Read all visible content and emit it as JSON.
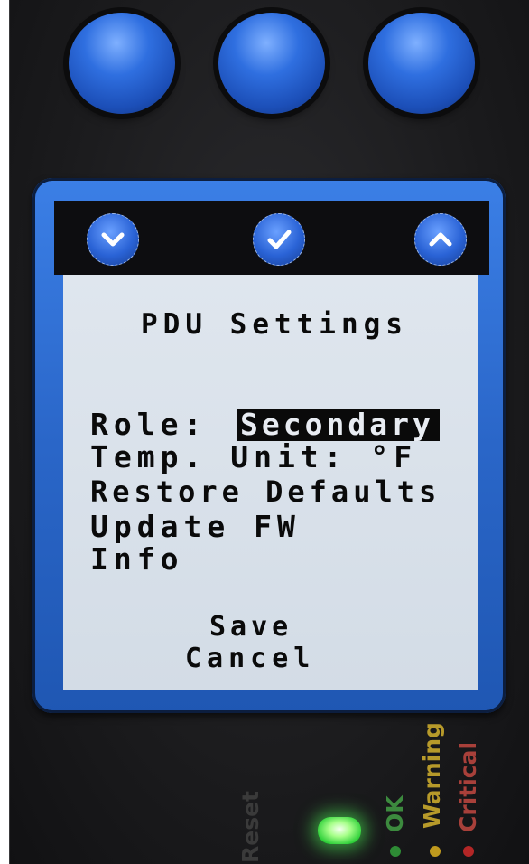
{
  "screen": {
    "title": "PDU Settings",
    "menu": {
      "role_label": "Role:",
      "role_value": "Secondary",
      "temp_unit": "Temp. Unit: °F",
      "restore_defaults": "Restore Defaults",
      "update_fw": "Update FW",
      "info": "Info"
    },
    "actions": {
      "save": "Save",
      "cancel": "Cancel"
    }
  },
  "nav_icons": [
    "chevron-down-icon",
    "checkmark-icon",
    "chevron-up-icon"
  ],
  "indicators": {
    "reset": "Reset",
    "ok": "OK",
    "warning": "Warning",
    "critical": "Critical"
  },
  "colors": {
    "button_blue": "#2f6fe0",
    "bezel_blue": "#2a66c8",
    "lcd_background": "#d8e0ea",
    "selection": "#0a0a0a",
    "led_green": "#2fd03a",
    "ok": "#2e8b35",
    "warning": "#c09a1e",
    "critical": "#b32626"
  }
}
